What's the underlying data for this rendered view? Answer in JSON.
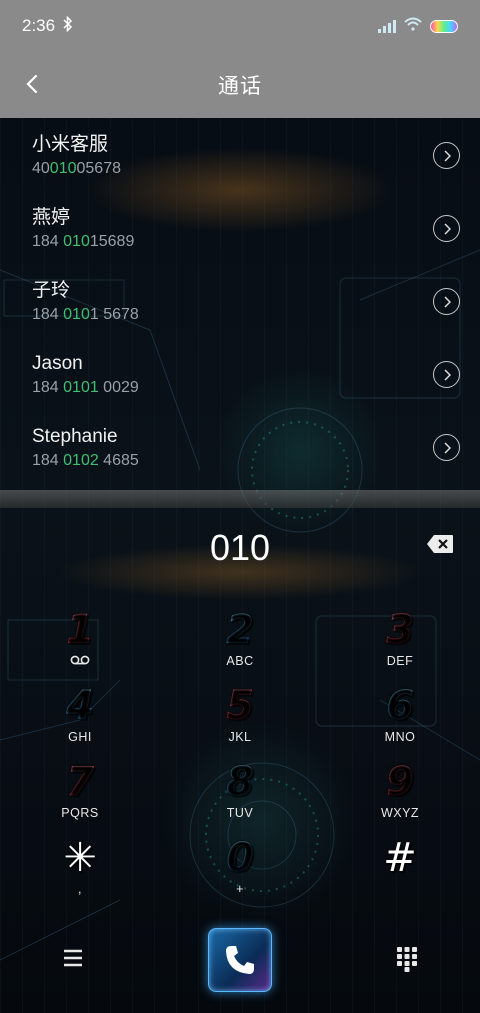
{
  "status_bar": {
    "time": "2:36",
    "bluetooth_icon": "bluetooth-icon",
    "signal_icon": "signal-icon",
    "wifi_icon": "wifi-icon",
    "battery_icon": "battery-icon"
  },
  "header": {
    "title": "通话",
    "back_icon": "chevron-left-icon"
  },
  "contacts": [
    {
      "name": "小米客服",
      "number_pre": "40",
      "number_hl": "010",
      "number_post": "05678"
    },
    {
      "name": "燕婷",
      "number_pre": "184 ",
      "number_hl": "010",
      "number_post": "15689"
    },
    {
      "name": "子玲",
      "number_pre": "184 ",
      "number_hl": "010",
      "number_post": "1 5678"
    },
    {
      "name": "Jason",
      "number_pre": "184 ",
      "number_hl": "0101",
      "number_post": " 0029"
    },
    {
      "name": "Stephanie",
      "number_pre": "184 ",
      "number_hl": "0102",
      "number_post": " 4685"
    }
  ],
  "dialer": {
    "input": "010",
    "backspace_icon": "backspace-icon"
  },
  "keypad": [
    {
      "digit": "1",
      "letters": "",
      "style": "red",
      "voicemail": true
    },
    {
      "digit": "2",
      "letters": "ABC",
      "style": "blue"
    },
    {
      "digit": "3",
      "letters": "DEF",
      "style": "red"
    },
    {
      "digit": "4",
      "letters": "GHI",
      "style": "blue"
    },
    {
      "digit": "5",
      "letters": "JKL",
      "style": "red"
    },
    {
      "digit": "6",
      "letters": "MNO",
      "style": "blue"
    },
    {
      "digit": "7",
      "letters": "PQRS",
      "style": "red"
    },
    {
      "digit": "8",
      "letters": "TUV",
      "style": "blue"
    },
    {
      "digit": "9",
      "letters": "WXYZ",
      "style": "red"
    },
    {
      "digit": "✳",
      "letters": ",",
      "style": "white"
    },
    {
      "digit": "0",
      "letters": "+",
      "style": "blue"
    },
    {
      "digit": "#",
      "letters": "",
      "style": "white"
    }
  ],
  "bottom_bar": {
    "menu_icon": "menu-icon",
    "call_icon": "phone-icon",
    "keypad_icon": "keypad-icon"
  },
  "colors": {
    "title_bar": "#8a8a8a",
    "highlight": "#3fbf72",
    "digit_red": "#ff4a5c",
    "digit_blue": "#1d8cf0"
  }
}
